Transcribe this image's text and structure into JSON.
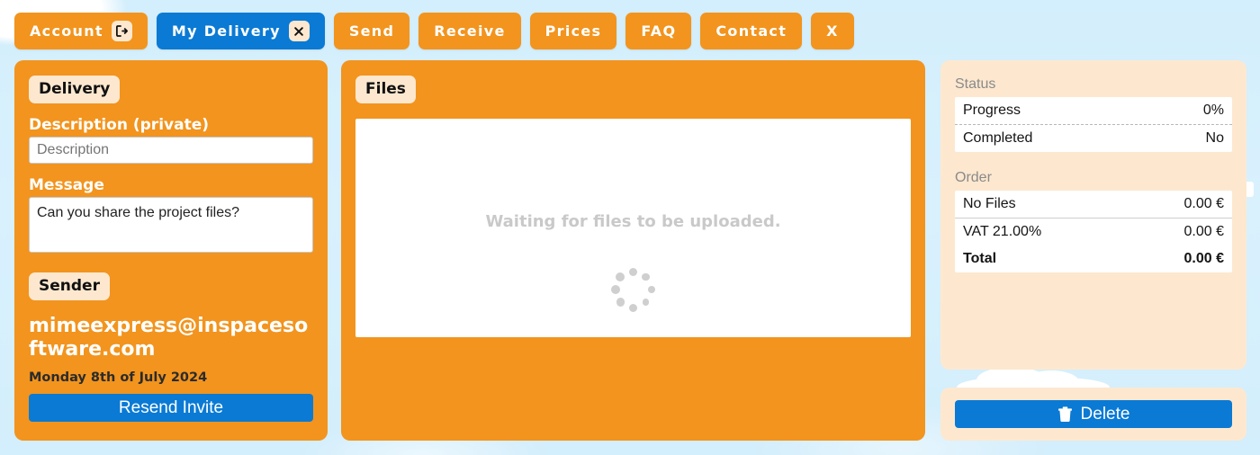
{
  "theme": {
    "orange": "#f2941e",
    "blue": "#0a7ad4",
    "cream": "#fde8cf",
    "sky": "#d7f0fc",
    "white": "#ffffff"
  },
  "tabs": [
    {
      "label": "Account",
      "active": false,
      "badge": "sign-out-icon"
    },
    {
      "label": "My Delivery",
      "active": true,
      "badge": "close-x-icon"
    },
    {
      "label": "Send",
      "active": false,
      "badge": null
    },
    {
      "label": "Receive",
      "active": false,
      "badge": null
    },
    {
      "label": "Prices",
      "active": false,
      "badge": null
    },
    {
      "label": "FAQ",
      "active": false,
      "badge": null
    },
    {
      "label": "Contact",
      "active": false,
      "badge": null
    },
    {
      "label": "X",
      "active": false,
      "badge": null
    }
  ],
  "delivery": {
    "chip": "Delivery",
    "description_label": "Description (private)",
    "description_placeholder": "Description",
    "description_value": "",
    "message_label": "Message",
    "message_value": "Can you share the project files?",
    "sender_chip": "Sender",
    "sender_email": "mimeexpress@inspacesoftware.com",
    "sender_date": "Monday 8th of July 2024",
    "resend_label": "Resend Invite"
  },
  "files": {
    "chip": "Files",
    "waiting_text": "Waiting for files to be uploaded.",
    "spinner": "loading-spinner-icon"
  },
  "status": {
    "group_title": "Status",
    "rows": [
      {
        "label": "Progress",
        "value": "0%"
      },
      {
        "label": "Completed",
        "value": "No"
      }
    ]
  },
  "order": {
    "group_title": "Order",
    "rows": [
      {
        "label": "No Files",
        "value": "0.00 €",
        "bold": false
      },
      {
        "label": "VAT 21.00%",
        "value": "0.00 €",
        "bold": false
      },
      {
        "label": "Total",
        "value": "0.00 €",
        "bold": true
      }
    ]
  },
  "actions": {
    "delete_label": "Delete",
    "delete_icon": "trash-icon"
  }
}
